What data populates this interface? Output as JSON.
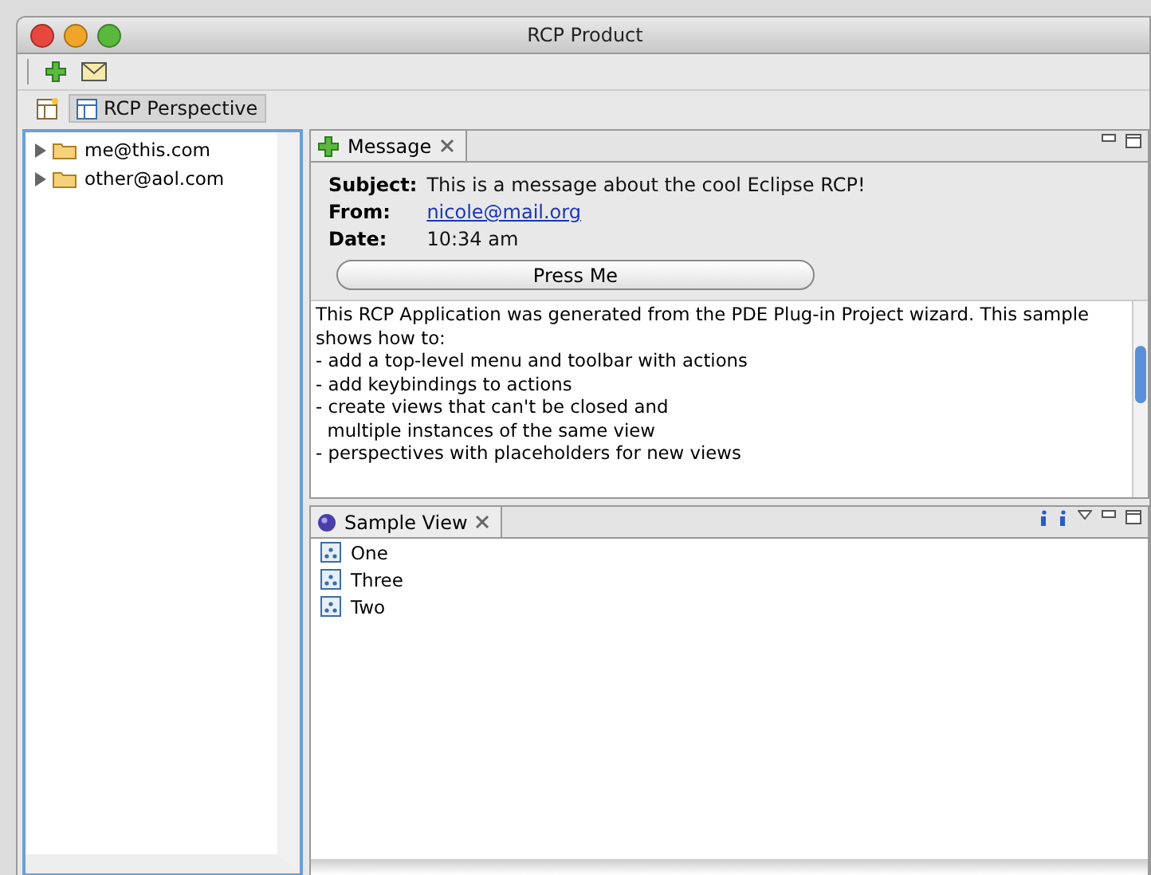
{
  "window": {
    "title": "RCP Product"
  },
  "toolbar": [
    {
      "kind": "add"
    },
    {
      "kind": "mail"
    }
  ],
  "perspectives": [
    {
      "kind": "open"
    },
    {
      "kind": "perspective",
      "label": "RCP Perspective",
      "selected": true
    }
  ],
  "navigator": {
    "items": [
      {
        "label": "me@this.com",
        "expanded": false
      },
      {
        "label": "other@aol.com",
        "expanded": false
      }
    ]
  },
  "message_view": {
    "tab": "Message",
    "fields": [
      {
        "label": "Subject:",
        "value": "This is a message about the cool Eclipse RCP!",
        "kind": "text"
      },
      {
        "label": "From:",
        "value": "nicole@mail.org",
        "kind": "link"
      },
      {
        "label": "Date:",
        "value": "10:34 am",
        "kind": "text"
      }
    ],
    "button": "Press Me",
    "body": [
      "This RCP Application was generated from the PDE Plug-in Project wizard. This sample",
      "shows how to:",
      "- add a top-level menu and toolbar with actions",
      "- add keybindings to actions",
      "- create views that can't be closed and",
      "  multiple instances of the same view",
      "- perspectives with placeholders for new views"
    ]
  },
  "sample_view": {
    "tab": "Sample View",
    "items": [
      {
        "label": "One"
      },
      {
        "label": "Three"
      },
      {
        "label": "Two"
      }
    ]
  }
}
